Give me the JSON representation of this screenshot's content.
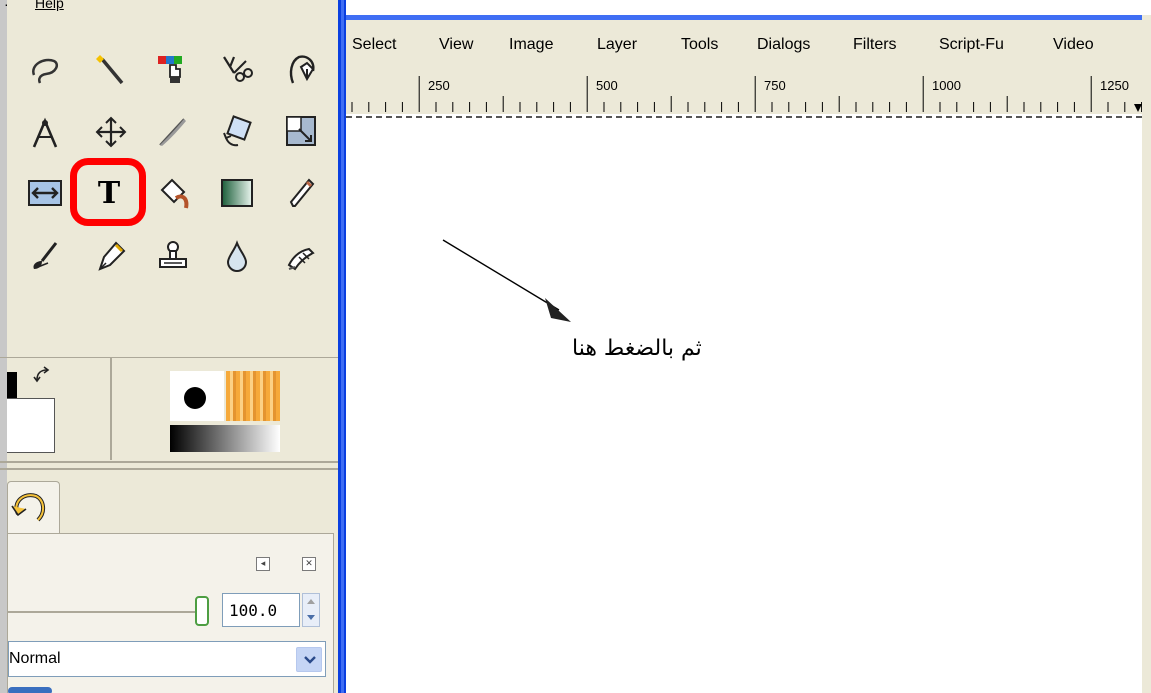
{
  "toolbox": {
    "menu": {
      "help_label": "Help"
    },
    "tools": [
      {
        "name": "free-select-icon"
      },
      {
        "name": "fuzzy-select-icon"
      },
      {
        "name": "select-by-color-icon"
      },
      {
        "name": "scissors-select-icon"
      },
      {
        "name": "foreground-select-icon"
      },
      {
        "name": "measure-icon"
      },
      {
        "name": "move-icon"
      },
      {
        "name": "crop-icon"
      },
      {
        "name": "rotate-icon"
      },
      {
        "name": "scale-icon"
      },
      {
        "name": "flip-icon"
      },
      {
        "name": "text-icon",
        "label": "T"
      },
      {
        "name": "bucket-fill-icon"
      },
      {
        "name": "blend-icon"
      },
      {
        "name": "pencil-icon"
      },
      {
        "name": "paintbrush-icon"
      },
      {
        "name": "ink-icon"
      },
      {
        "name": "clone-icon"
      },
      {
        "name": "blur-icon"
      },
      {
        "name": "smudge-icon"
      }
    ],
    "highlight_color": "#ff0000",
    "opacity_value": "100.0",
    "mode_value": "Normal"
  },
  "image_window": {
    "menu": [
      "Select",
      "View",
      "Image",
      "Layer",
      "Tools",
      "Dialogs",
      "Filters",
      "Script-Fu",
      "Video"
    ],
    "ruler_labels": [
      "250",
      "500",
      "750",
      "1000",
      "1250"
    ],
    "annotation": "ثم بالضغط هنا"
  },
  "colors": {
    "accent_blue": "#0a3fe0",
    "chrome": "#ece9d8"
  }
}
